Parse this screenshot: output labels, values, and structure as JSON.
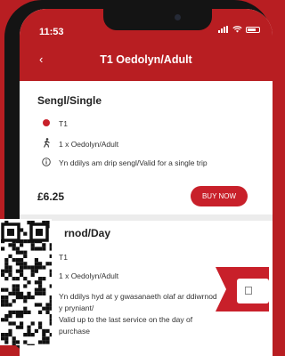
{
  "status_bar": {
    "time": "11:53"
  },
  "nav": {
    "back_icon": "chevron-left-icon",
    "title": "T1 Oedolyn/Adult"
  },
  "single": {
    "title": "Sengl/Single",
    "ticket": "T1",
    "passenger": "1 x Oedolyn/Adult",
    "validity": "Yn ddilys am drip sengl/Valid for a single trip",
    "price": "£6.25",
    "buy_label": "BUY NOW"
  },
  "day": {
    "title": "rnod/Day",
    "ticket": "T1",
    "passenger": "1 x Oedolyn/Adult",
    "validity_lines": [
      "Yn ddilys hyd at y gwasanaeth olaf ar ddiwrnod",
      "y pryniant/",
      "Valid up to the last service on the day of",
      "purchase"
    ]
  },
  "colors": {
    "brand_red": "#b81e22",
    "button_red": "#c8202a"
  },
  "icons": [
    "chevron-left-icon",
    "red-dot-icon",
    "walking-person-icon",
    "info-icon",
    "apple-icon",
    "qr-code-icon"
  ]
}
